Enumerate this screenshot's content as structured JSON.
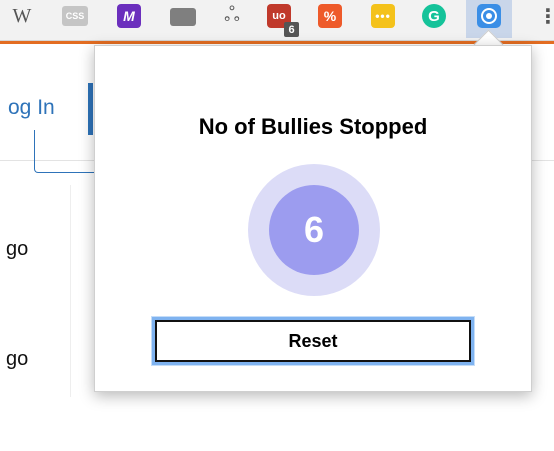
{
  "toolbar": {
    "extensions": [
      {
        "icon": "wikipedia-icon",
        "label": "W"
      },
      {
        "icon": "css-icon",
        "label": "CSS"
      },
      {
        "icon": "m-logo-icon",
        "label": "M"
      },
      {
        "icon": "box-icon",
        "label": ""
      },
      {
        "icon": "fork-icon",
        "label": "ஃ"
      },
      {
        "icon": "ublock-icon",
        "label": "uo",
        "badge": "6"
      },
      {
        "icon": "percent-icon",
        "label": "%"
      },
      {
        "icon": "dots-icon",
        "label": "•••"
      },
      {
        "icon": "grammarly-icon",
        "label": "G"
      },
      {
        "icon": "bully-blocker-icon",
        "label": "",
        "active": true
      }
    ],
    "menu_label": "⋮"
  },
  "page": {
    "login_text": "og In",
    "fragment_1": "go",
    "fragment_2": "go"
  },
  "popup": {
    "title": "No of Bullies Stopped",
    "count": "6",
    "reset_label": "Reset"
  },
  "colors": {
    "accent_orange": "#e36d22",
    "link_blue": "#2e73b9",
    "counter_outer": "#dcdcf7",
    "counter_inner": "#9c9cef",
    "focus_ring": "#7fb3f0"
  }
}
